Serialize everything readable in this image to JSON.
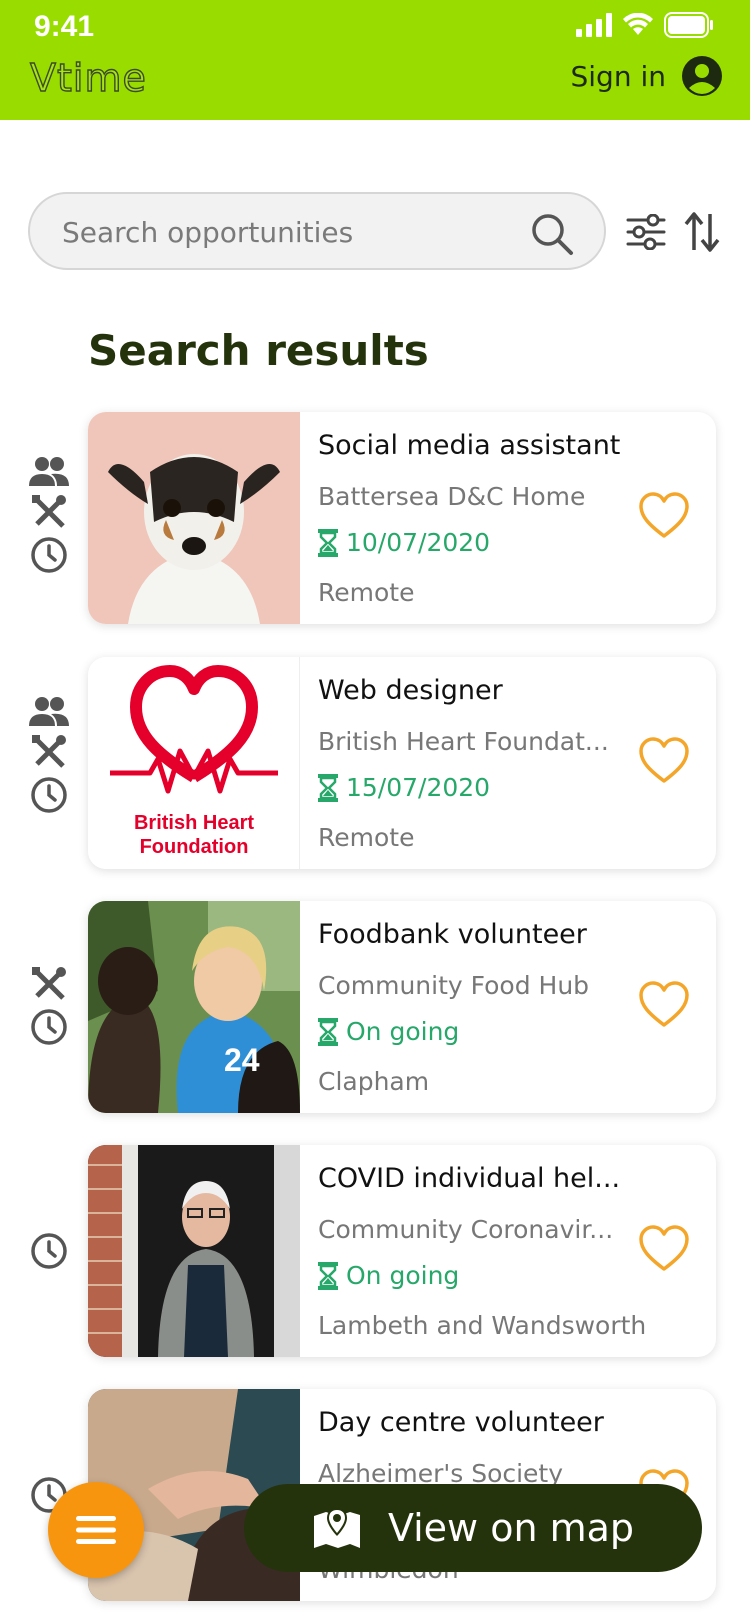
{
  "status_bar": {
    "time": "9:41"
  },
  "header": {
    "logo": "Vtime",
    "signin_label": "Sign in",
    "bg_color": "#99dd00"
  },
  "search": {
    "placeholder": "Search opportunities"
  },
  "results": {
    "title": "Search results",
    "items": [
      {
        "title": "Social media assistant",
        "org": "Battersea D&C Home",
        "date": "10/07/2020",
        "location": "Remote",
        "image": "dog-photo",
        "icons": [
          "group-icon",
          "tools-icon",
          "clock-icon"
        ]
      },
      {
        "title": "Web designer",
        "org": "British Heart Foundat...",
        "date": "15/07/2020",
        "location": "Remote",
        "image": "bhf-logo",
        "logo_text_1": "British Heart",
        "logo_text_2": "Foundation",
        "icons": [
          "group-icon",
          "tools-icon",
          "clock-icon"
        ]
      },
      {
        "title": "Foodbank volunteer",
        "org": "Community Food Hub",
        "date": "On going",
        "location": "Clapham",
        "image": "volunteers-photo",
        "icons": [
          "tools-icon",
          "clock-icon"
        ]
      },
      {
        "title": "COVID individual hel...",
        "org": "Community Coronavir...",
        "date": "On going",
        "location": "Lambeth and Wandsworth",
        "image": "elderly-man-photo",
        "icons": [
          "clock-icon"
        ]
      },
      {
        "title": "Day centre volunteer",
        "org": "Alzheimer's Society",
        "date": "",
        "location": "Wimbledon",
        "image": "holding-hands-photo",
        "icons": [
          "clock-icon"
        ]
      }
    ]
  },
  "fab": {
    "icon": "menu-icon"
  },
  "map_button": {
    "label": "View on map",
    "icon": "map-icon"
  },
  "colors": {
    "accent": "#99dd00",
    "dark": "#24330c",
    "orange": "#f7950f",
    "date_green": "#27a86a",
    "heart": "#f4a62a"
  }
}
